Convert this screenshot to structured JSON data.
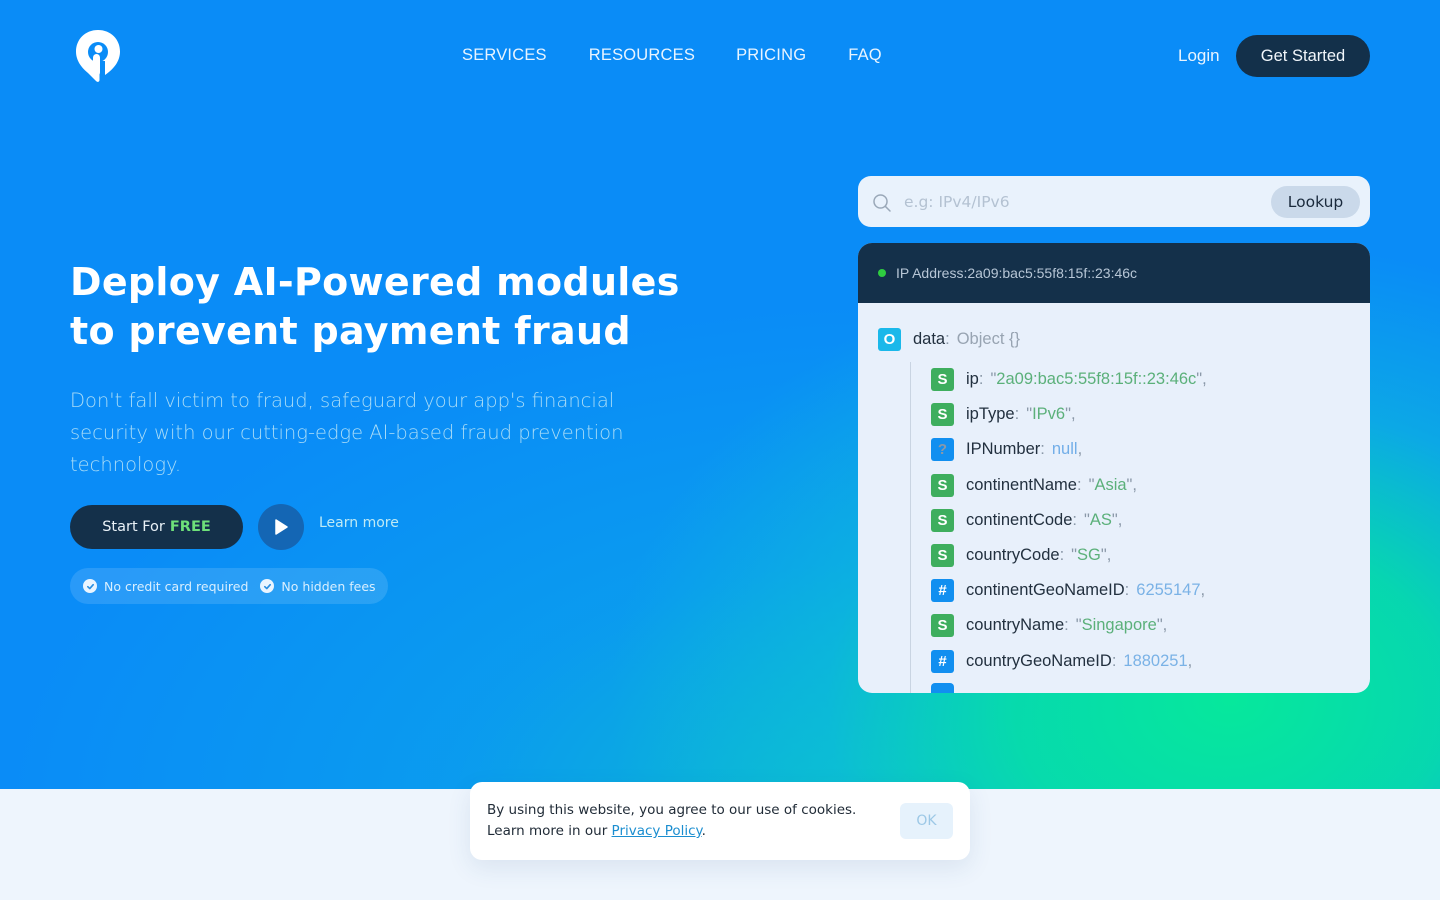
{
  "nav": {
    "logo_name": "brand-logo",
    "links": [
      "SERVICES",
      "RESOURCES",
      "PRICING",
      "FAQ"
    ],
    "login_label": "Login",
    "get_started_label": "Get Started"
  },
  "hero": {
    "headline": "Deploy AI-Powered modules to prevent payment fraud",
    "subtext": "Don't fall victim to fraud, safeguard your app's financial security with our cutting-edge AI-based fraud prevention technology.",
    "start_label": "Start For",
    "start_highlight": "FREE",
    "learn_more_label": "Learn more",
    "perks": [
      "No credit card required",
      "No hidden fees"
    ]
  },
  "lookup": {
    "placeholder": "e.g: IPv4/IPv6",
    "value": "",
    "button_label": "Lookup"
  },
  "result": {
    "status_color": "#2ecc40",
    "header_label": "IP Address:2a09:bac5:55f8:15f::23:46c",
    "root": {
      "badge": "O",
      "key": "data",
      "type_label": "Object {}"
    },
    "fields": [
      {
        "badge": "S",
        "kind": "string",
        "key": "ip",
        "value": "2a09:bac5:55f8:15f::23:46c"
      },
      {
        "badge": "S",
        "kind": "string",
        "key": "ipType",
        "value": "IPv6"
      },
      {
        "badge": "?",
        "kind": "null",
        "key": "IPNumber",
        "value": "null"
      },
      {
        "badge": "S",
        "kind": "string",
        "key": "continentName",
        "value": "Asia"
      },
      {
        "badge": "S",
        "kind": "string",
        "key": "continentCode",
        "value": "AS"
      },
      {
        "badge": "S",
        "kind": "string",
        "key": "countryCode",
        "value": "SG"
      },
      {
        "badge": "#",
        "kind": "number",
        "key": "continentGeoNameID",
        "value": "6255147"
      },
      {
        "badge": "S",
        "kind": "string",
        "key": "countryName",
        "value": "Singapore"
      },
      {
        "badge": "#",
        "kind": "number",
        "key": "countryGeoNameID",
        "value": "1880251"
      }
    ]
  },
  "cookie": {
    "line1": "By using this website, you agree to our use of cookies.",
    "line2_prefix": "Learn more in our",
    "link_label": "Privacy Policy",
    "line2_suffix": ".",
    "ok_label": "OK"
  },
  "colors": {
    "hero_blue": "#0a8cf7",
    "hero_green": "#06e89c",
    "dark_navy": "#14304a",
    "free_green": "#6ee07a",
    "string_badge": "#3eae5e",
    "number_badge": "#118ff0",
    "object_badge": "#1ab8ea"
  }
}
